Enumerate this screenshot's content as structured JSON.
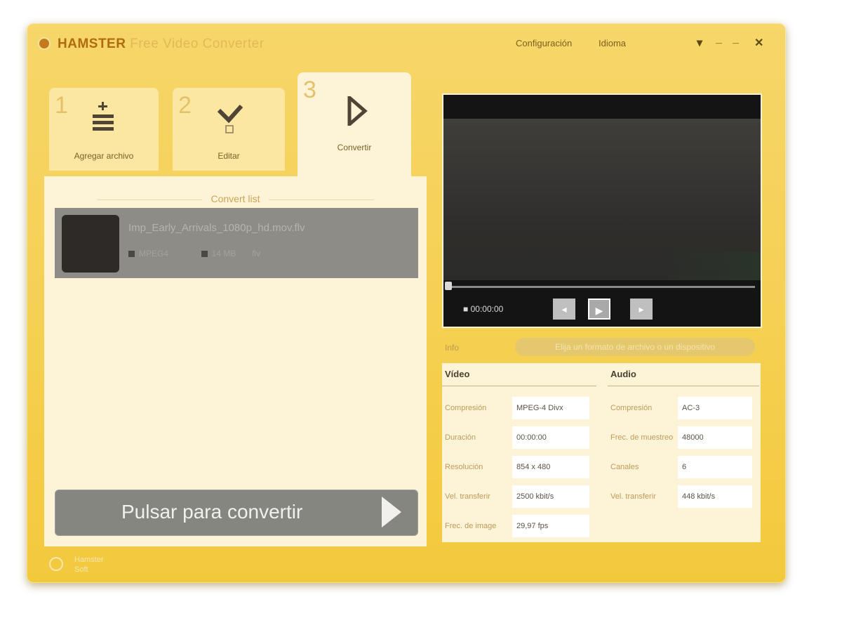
{
  "app": {
    "brand": "HAMSTER",
    "title_rest": "Free Video Converter",
    "menu_settings": "Configuración",
    "menu_language": "Idioma",
    "btn_dropdown": "▾",
    "btn_minimize": "_",
    "btn_restore": "_",
    "btn_close": "✕"
  },
  "steps": [
    {
      "num": "1",
      "label": "Agregar archivo",
      "icon": "add-list-icon"
    },
    {
      "num": "2",
      "label": "Editar",
      "icon": "checkmark-icon"
    },
    {
      "num": "3",
      "label": "Convertir",
      "icon": "play-arrow-icon"
    }
  ],
  "file_list": {
    "title": "Convert list",
    "file_name": "Imp_Early_Arrivals_1080p_hd.mov.flv",
    "meta_format": "MPEG4",
    "meta_size": "14 MB",
    "meta_extra": "flv"
  },
  "convert": {
    "label": "Pulsar para convertir"
  },
  "player": {
    "time": "00:00:00",
    "btn_prev": "◂",
    "btn_play": "▶",
    "btn_next": "▸",
    "progress": 0
  },
  "info": {
    "label": "Info",
    "pill": "Elija un formato de archivo o un dispositivo"
  },
  "video": {
    "heading": "Vídeo",
    "rows": [
      {
        "label": "Compresión",
        "value": "MPEG-4 Divx"
      },
      {
        "label": "Duración",
        "value": "00:00:00"
      },
      {
        "label": "Resolución",
        "value": "854 x 480"
      },
      {
        "label": "Vel. transferir",
        "value": "2500 kbit/s"
      },
      {
        "label": "Frec. de image",
        "value": "29,97 fps"
      }
    ]
  },
  "audio": {
    "heading": "Audio",
    "rows": [
      {
        "label": "Compresión",
        "value": "AC-3"
      },
      {
        "label": "Frec. de muestreo",
        "value": "48000"
      },
      {
        "label": "Canales",
        "value": "6"
      },
      {
        "label": "Vel. transferir",
        "value": "448 kbit/s"
      }
    ]
  },
  "status": {
    "line1": "Hamster",
    "line2": "Soft"
  },
  "colors": {
    "window": "#f5cf4f",
    "panel": "#fdf3d6",
    "button": "#868681"
  }
}
